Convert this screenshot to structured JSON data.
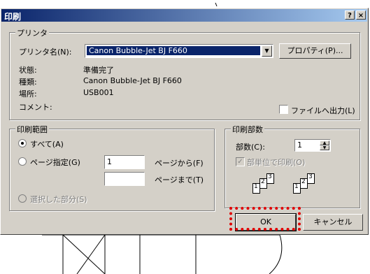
{
  "title": "印刷",
  "title_buttons": {
    "help": "?",
    "close": "×"
  },
  "printer": {
    "group_label": "プリンタ",
    "name_label": "プリンタ名(N):",
    "name_value": "Canon Bubble-Jet BJ F660",
    "properties_button": "プロパティ(P)...",
    "status_label": "状態:",
    "status_value": "準備完了",
    "type_label": "種類:",
    "type_value": "Canon Bubble-Jet BJ F660",
    "location_label": "場所:",
    "location_value": "USB001",
    "comment_label": "コメント:",
    "print_to_file": "ファイルへ出力(L)"
  },
  "range": {
    "group_label": "印刷範囲",
    "all": "すべて(A)",
    "pages": "ページ指定(G)",
    "from_value": "1",
    "to_value": "",
    "from_label": "ページから(F)",
    "to_label": "ページまで(T)",
    "selection": "選択した部分(S)"
  },
  "copies": {
    "group_label": "印刷部数",
    "count_label": "部数(C):",
    "count_value": "1",
    "collate": "部単位で印刷(O)",
    "collate_checked": true
  },
  "buttons": {
    "ok": "OK",
    "cancel": "キャンセル"
  },
  "colors": {
    "highlight": "#e00000",
    "title_start": "#0a246a",
    "title_end": "#a6caf0"
  }
}
